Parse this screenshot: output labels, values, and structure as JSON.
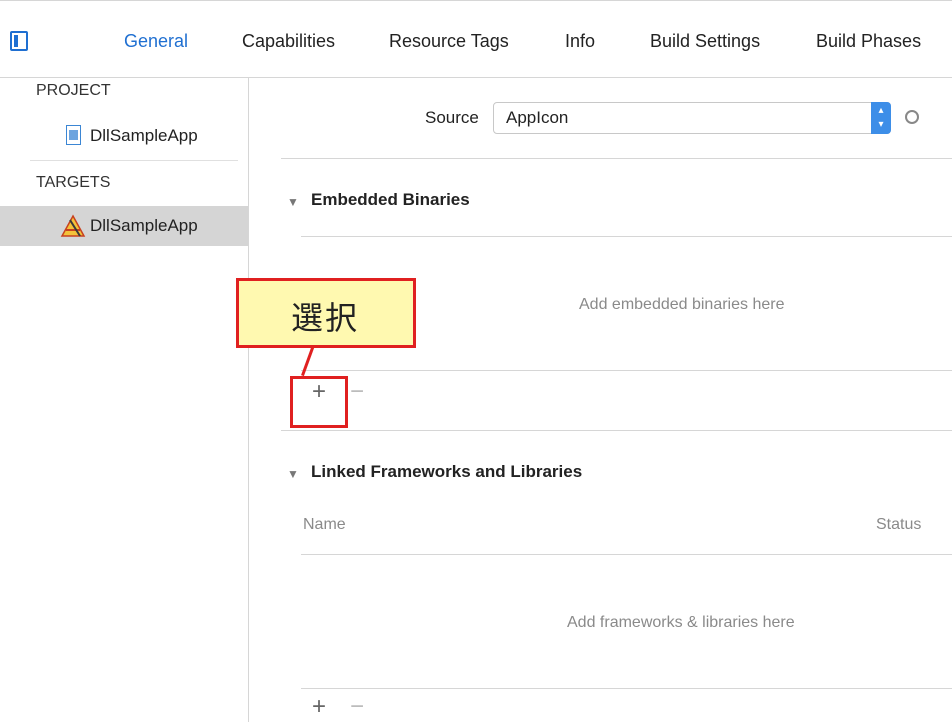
{
  "tabs": {
    "general": "General",
    "capabilities": "Capabilities",
    "resource_tags": "Resource Tags",
    "info": "Info",
    "build_settings": "Build Settings",
    "build_phases": "Build Phases"
  },
  "sidebar": {
    "project_header": "PROJECT",
    "project_item": "DllSampleApp",
    "targets_header": "TARGETS",
    "target_item": "DllSampleApp"
  },
  "source": {
    "label": "Source",
    "value": "AppIcon"
  },
  "embedded_binaries": {
    "title": "Embedded Binaries",
    "placeholder": "Add embedded binaries here",
    "add": "+",
    "remove": "−"
  },
  "linked_frameworks": {
    "title": "Linked Frameworks and Libraries",
    "col_name": "Name",
    "col_status": "Status",
    "placeholder": "Add frameworks & libraries here",
    "add": "+",
    "remove": "−"
  },
  "annotation": {
    "callout_text": "選択"
  },
  "colors": {
    "accent": "#1f6fd1",
    "callout_fill": "#fff9b0",
    "callout_border": "#e02020"
  }
}
